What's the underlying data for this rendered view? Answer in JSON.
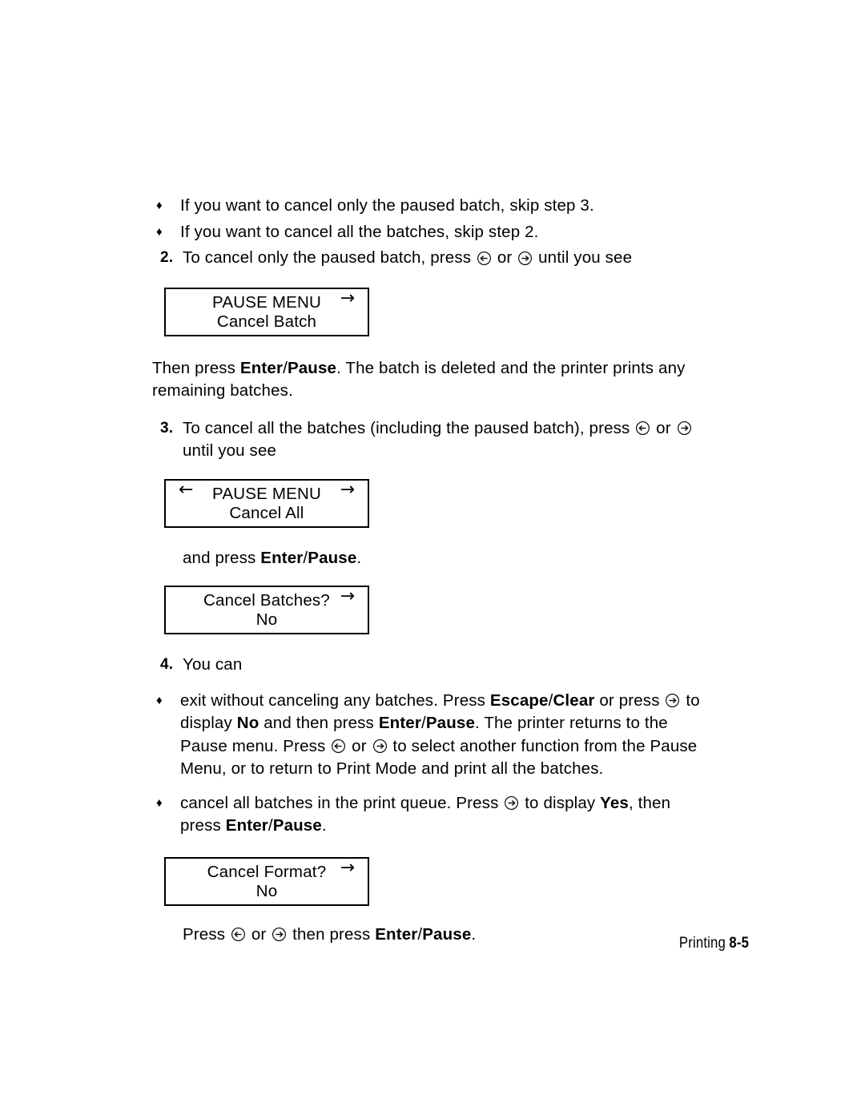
{
  "document": {
    "footer": {
      "section_label": "Printing",
      "page_number": "8-5"
    }
  },
  "body": {
    "bullet_1": "If you want to cancel only the paused batch, skip step 3.",
    "bullet_2": "If you want to cancel all the batches, skip step 2.",
    "step_2": {
      "number": "2.",
      "text_a": "To cancel only the paused batch, press",
      "text_b": "or",
      "text_c": "until you see"
    },
    "after_box_1": {
      "text_a": "Then press",
      "bold_enter": "Enter",
      "slash": "/",
      "bold_pause": "Pause",
      "text_b": ".  The batch is deleted and the printer prints any remaining batches."
    },
    "step_3": {
      "number": "3.",
      "text_a": "To cancel all the batches (including the paused batch), press",
      "text_b": "or",
      "text_c": "until you see"
    },
    "after_box_2": {
      "text_a": "and press",
      "bold_enter": "Enter",
      "slash": "/",
      "bold_pause": "Pause",
      "text_b": "."
    },
    "step_4": {
      "number": "4.",
      "text": "You can"
    },
    "bullet_3": {
      "t1": "exit without canceling any batches.  Press",
      "b1": "Escape",
      "s1": "/",
      "b2": "Clear",
      "t2": "or press",
      "t3": "to display",
      "b3": "No",
      "t4": "and then press",
      "b4": "Enter",
      "s2": "/",
      "b5": "Pause",
      "t5": ".  The printer returns to the Pause menu.  Press",
      "t6": "or",
      "t7": "to select another function from the Pause Menu, or to return to Print Mode and print all the batches."
    },
    "bullet_4": {
      "t1": "cancel all batches in the print queue.  Press",
      "t2": "to display",
      "b1": "Yes",
      "t3": ", then press",
      "b2": "Enter",
      "s1": "/",
      "b3": "Pause",
      "t4": "."
    },
    "final_line": {
      "t1": "Press",
      "t2": "or",
      "t3": "then press",
      "b1": "Enter",
      "s1": "/",
      "b2": "Pause",
      "t4": "."
    }
  },
  "displays": {
    "box_1": {
      "line1": "PAUSE MENU",
      "line2": "Cancel Batch",
      "arrow_right": "→",
      "has_left_arrow": false
    },
    "box_2": {
      "line1": "PAUSE MENU",
      "line2": "Cancel All",
      "arrow_left": "←",
      "arrow_right": "→",
      "has_left_arrow": true
    },
    "box_3": {
      "line1": "Cancel Batches?",
      "line2": "No",
      "arrow_right": "→",
      "has_left_arrow": false
    },
    "box_4": {
      "line1": "Cancel Format?",
      "line2": "No",
      "arrow_right": "→",
      "has_left_arrow": false
    }
  },
  "icons": {
    "bullet_diamond": "♦",
    "left_arrow_key_name": "circled-left-arrow-key",
    "right_arrow_key_name": "circled-right-arrow-key"
  },
  "colors": {
    "text": "#000000",
    "page_background": "#ffffff",
    "display_border": "#000000"
  }
}
